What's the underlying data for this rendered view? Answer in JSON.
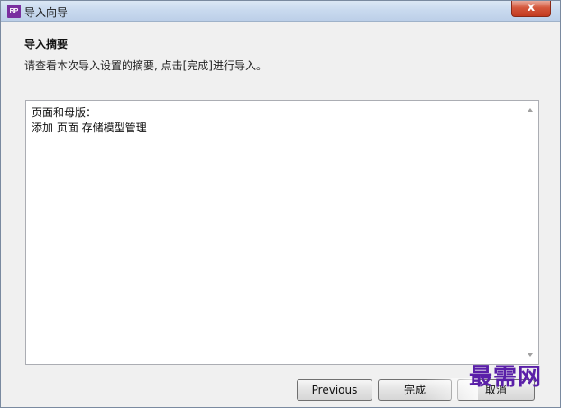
{
  "window": {
    "title": "导入向导",
    "app_icon_text": "RP",
    "close_glyph": "x"
  },
  "header": {
    "heading": "导入摘要",
    "subtitle": "请查看本次导入设置的摘要, 点击[完成]进行导入。"
  },
  "summary": {
    "lines": [
      "页面和母版：",
      "添加 页面 存储模型管理"
    ]
  },
  "buttons": {
    "previous": "Previous",
    "finish": "完成",
    "cancel": "取消"
  },
  "watermark": "最需网",
  "colors": {
    "accent": "#5a1fa8",
    "close": "#c23a1f"
  }
}
